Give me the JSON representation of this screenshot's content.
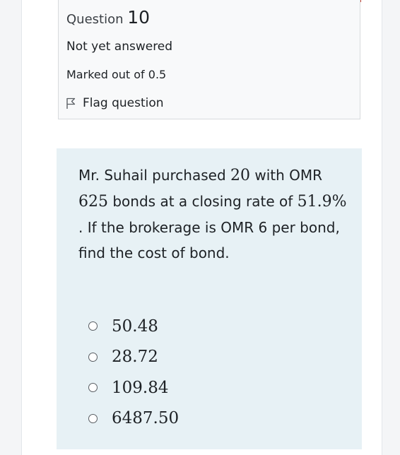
{
  "question_info": {
    "title_prefix": "Question",
    "number": "10",
    "state": "Not yet answered",
    "marked_out_of": "Marked out of 0.5",
    "flag_label": "Flag question",
    "flag_icon": "flag-outline-icon"
  },
  "question": {
    "part1": "Mr. Suhail  purchased ",
    "qty": "20",
    "part2": " with OMR ",
    "face_value": "625",
    "part3": "  bonds at a closing rate of ",
    "rate": "51.9%",
    "part4": " . If the brokerage is OMR 6 per bond, find the cost of bond."
  },
  "answers": [
    {
      "label": "50.48"
    },
    {
      "label": "28.72"
    },
    {
      "label": "109.84"
    },
    {
      "label": "6487.50"
    }
  ],
  "colors": {
    "info_bg": "#f8f9fa",
    "question_bg": "#e7f1f5",
    "accent_top": "#c84a3a"
  }
}
